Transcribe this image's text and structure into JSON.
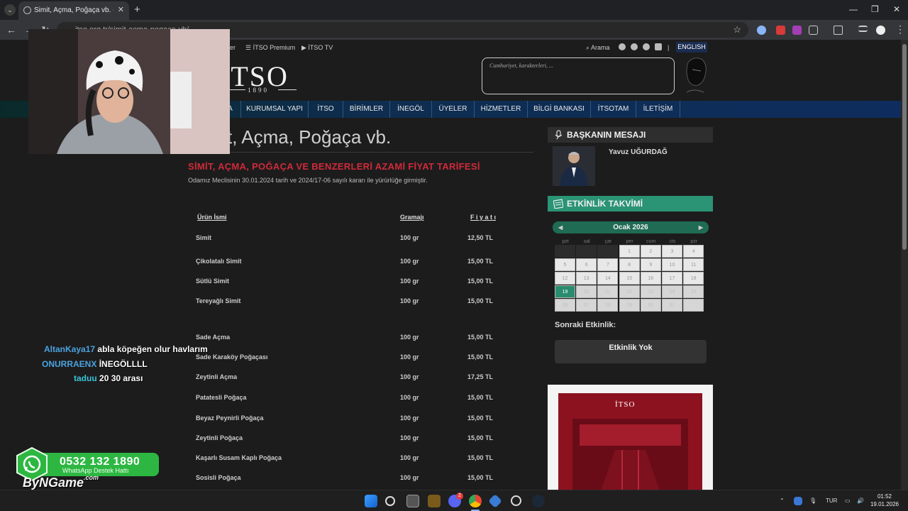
{
  "browser": {
    "tab_title": "Simit, Açma, Poğaça vb. - İTSO",
    "tab_close": "✕",
    "new_tab": "+",
    "address": "itso.org.tr/simit-acma-pogaca-vb/",
    "window_controls": [
      "—",
      "❐",
      "✕"
    ]
  },
  "site": {
    "top_links": [
      {
        "icon": "list-icon",
        "label": "İTSO Premium"
      },
      {
        "icon": "play-icon",
        "label": "İTSO TV"
      }
    ],
    "partial_link": "ler",
    "search_label": "Arama",
    "separator": "|",
    "language_button": "ENGLISH",
    "logo_text": "İTSO",
    "logo_year": "1890",
    "quote_text": "Cumhuriyet, karakterleri, ...",
    "nav": [
      "A",
      "KURUMSAL YAPI",
      "İTSO",
      "BİRİMLER",
      "İNEGÖL",
      "ÜYELER",
      "HİZMETLER",
      "BİLGİ BANKASI",
      "İTSOTAM",
      "İLETİŞİM"
    ]
  },
  "article": {
    "heading_visible": "t, Açma, Poğaça vb.",
    "section_title": "SİMİT, AÇMA, POĞAÇA VE BENZERLERİ AZAMİ FİYAT TARİFESİ",
    "description": "Odamız Meclisinin 30.01.2024 tarih ve 2024/17-06 sayılı kararı ile yürürlüğe girmiştir.",
    "columns": [
      "Ürün İsmi",
      "Gramajı",
      "F i y a t ı"
    ],
    "rows": [
      {
        "name": "Simit",
        "gram": "100 gr",
        "price": "12,50 TL"
      },
      {
        "name": "Çikolatalı Simit",
        "gram": "100 gr",
        "price": "15,00 TL"
      },
      {
        "name": "Sütlü Simit",
        "gram": "100 gr",
        "price": "15,00 TL"
      },
      {
        "name": "Tereyağlı Simit",
        "gram": "100 gr",
        "price": "15,00 TL"
      },
      {
        "name": "Sade Açma",
        "gram": "100 gr",
        "price": "15,00 TL"
      },
      {
        "name": "Sade Karaköy Poğaçası",
        "gram": "100 gr",
        "price": "15,00 TL"
      },
      {
        "name": "Zeytinli Açma",
        "gram": "100 gr",
        "price": "17,25 TL"
      },
      {
        "name": "Patatesli Poğaça",
        "gram": "100 gr",
        "price": "15,00 TL"
      },
      {
        "name": "Beyaz Peynirli Poğaça",
        "gram": "100 gr",
        "price": "15,00 TL"
      },
      {
        "name": "Zeytinli Poğaça",
        "gram": "100 gr",
        "price": "15,00 TL"
      },
      {
        "name": "Kaşarlı Susam Kaplı Poğaça",
        "gram": "100 gr",
        "price": "15,00 TL"
      },
      {
        "name": "Sosisli Poğaça",
        "gram": "100 gr",
        "price": "15,00 TL"
      }
    ]
  },
  "sidebar": {
    "president_heading": "BAŞKANIN MESAJI",
    "president_name": "Yavuz UĞURDAĞ",
    "events_heading": "ETKİNLİK TAKVİMİ",
    "calendar": {
      "month": "Ocak 2026",
      "prev": "◀",
      "next": "▶",
      "weekdays": [
        "pzt",
        "sal",
        "çar",
        "per",
        "cum",
        "cts",
        "pzr"
      ],
      "days": [
        "",
        "",
        "",
        "1",
        "2",
        "3",
        "4",
        "5",
        "6",
        "7",
        "8",
        "9",
        "10",
        "11",
        "12",
        "13",
        "14",
        "15",
        "16",
        "17",
        "18",
        "19",
        "20",
        "21",
        "22",
        "23",
        "24",
        "25",
        "26",
        "27",
        "28",
        "29",
        "30",
        "31",
        ""
      ],
      "today": "19"
    },
    "next_event_label": "Sonraki Etkinlik:",
    "no_event": "Etkinlik Yok",
    "promo_logo": "İTSO"
  },
  "chat": [
    {
      "user": "AltanKaya17",
      "message": "abla köpeğen olur havlarım"
    },
    {
      "user": "ONURRAENX",
      "message": "İNEGÖLLLL"
    },
    {
      "user": "taduu",
      "message": "20 30 arası"
    }
  ],
  "whatsapp": {
    "phone": "0532 132 1890",
    "subtitle": "WhatsApp Destek Hattı",
    "brand": "ByNGame",
    "brand_suffix": ".com"
  },
  "taskbar": {
    "discord_badge": "2",
    "language": "TUR",
    "time": "01:52",
    "date": "19.01.2026"
  }
}
